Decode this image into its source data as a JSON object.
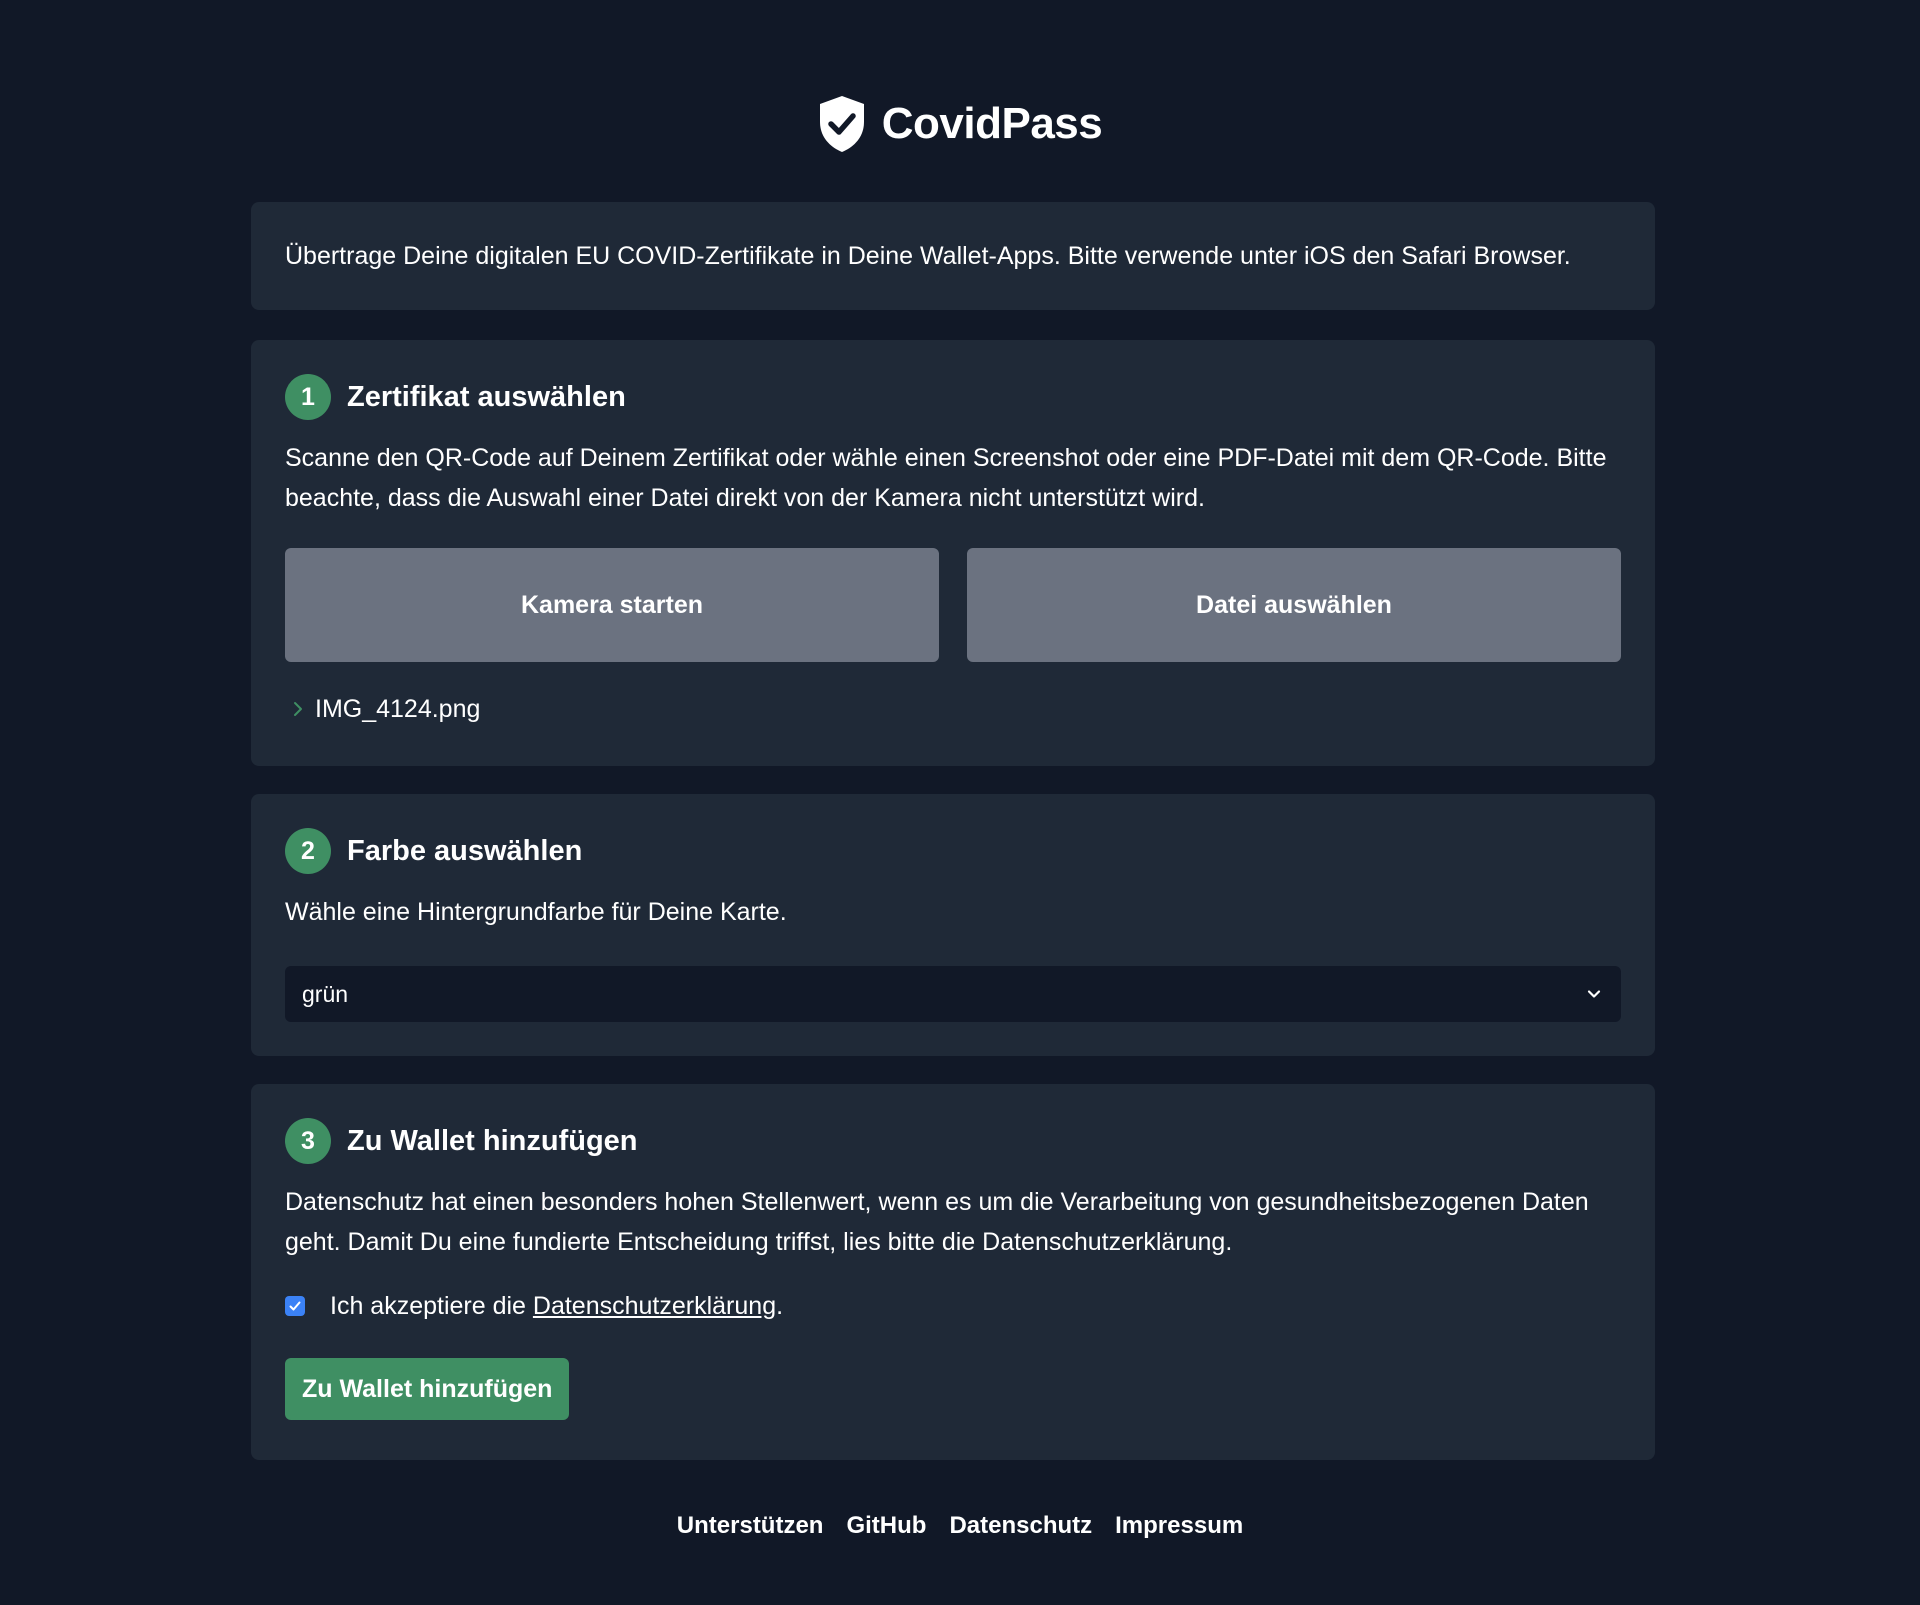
{
  "app": {
    "title": "CovidPass",
    "logo_icon": "shield-check-icon"
  },
  "intro": {
    "text": "Übertrage Deine digitalen EU COVID-Zertifikate in Deine Wallet-Apps. Bitte verwende unter iOS den Safari Browser."
  },
  "step1": {
    "number": "1",
    "title": "Zertifikat auswählen",
    "text": "Scanne den QR-Code auf Deinem Zertifikat oder wähle einen Screenshot oder eine PDF-Datei mit dem QR-Code. Bitte beachte, dass die Auswahl einer Datei direkt von der Kamera nicht unterstützt wird.",
    "camera_button": "Kamera starten",
    "file_button": "Datei auswählen",
    "selected_file": "IMG_4124.png"
  },
  "step2": {
    "number": "2",
    "title": "Farbe auswählen",
    "text": "Wähle eine Hintergrundfarbe für Deine Karte.",
    "selected_color": "grün"
  },
  "step3": {
    "number": "3",
    "title": "Zu Wallet hinzufügen",
    "text": "Datenschutz hat einen besonders hohen Stellenwert, wenn es um die Verarbeitung von gesundheitsbezogenen Daten geht. Damit Du eine fundierte Entscheidung triffst, lies bitte die Datenschutzerklärung.",
    "consent_prefix": "Ich akzeptiere die ",
    "consent_link": "Datenschutzerklärung",
    "consent_suffix": ".",
    "consent_checked": true,
    "add_button": "Zu Wallet hinzufügen"
  },
  "footer": {
    "links": [
      "Unterstützen",
      "GitHub",
      "Datenschutz",
      "Impressum"
    ]
  },
  "colors": {
    "background": "#111827",
    "card": "#1f2937",
    "accent_green": "#3f8f63",
    "button_gray": "#6b7280",
    "checkbox_blue": "#3b82f6"
  }
}
